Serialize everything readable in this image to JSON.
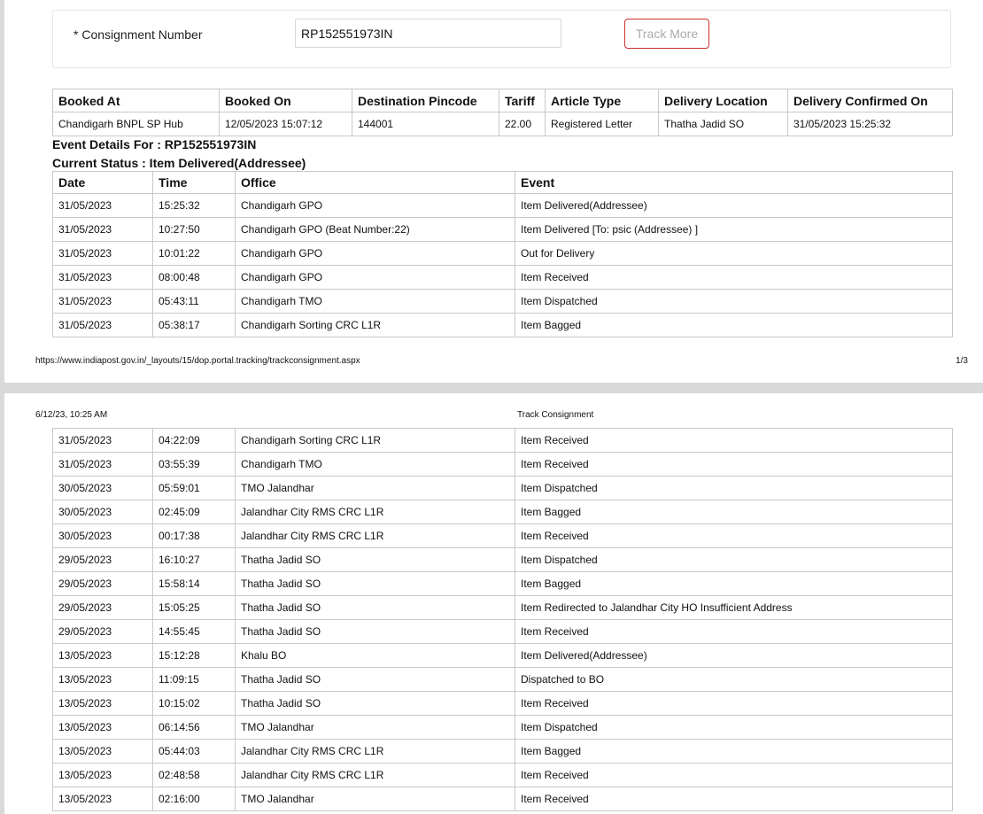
{
  "form": {
    "label": "* Consignment Number",
    "value": "RP152551973IN",
    "track_more_label": "Track More"
  },
  "booking": {
    "headers": [
      "Booked At",
      "Booked On",
      "Destination Pincode",
      "Tariff",
      "Article Type",
      "Delivery Location",
      "Delivery Confirmed On"
    ],
    "row": [
      "Chandigarh BNPL SP Hub",
      "12/05/2023 15:07:12",
      "144001",
      "22.00",
      "Registered Letter",
      "Thatha Jadid SO",
      "31/05/2023 15:25:32"
    ]
  },
  "event_details_title": "Event Details For : RP152551973IN",
  "current_status": "Current Status : Item Delivered(Addressee)",
  "events": {
    "headers": [
      "Date",
      "Time",
      "Office",
      "Event"
    ],
    "rows": [
      [
        "31/05/2023",
        "15:25:32",
        "Chandigarh GPO",
        "Item Delivered(Addressee)"
      ],
      [
        "31/05/2023",
        "10:27:50",
        "Chandigarh GPO (Beat Number:22)",
        "Item Delivered [To: psic (Addressee) ]"
      ],
      [
        "31/05/2023",
        "10:01:22",
        "Chandigarh GPO",
        "Out for Delivery"
      ],
      [
        "31/05/2023",
        "08:00:48",
        "Chandigarh GPO",
        "Item Received"
      ],
      [
        "31/05/2023",
        "05:43:11",
        "Chandigarh TMO",
        "Item Dispatched"
      ],
      [
        "31/05/2023",
        "05:38:17",
        "Chandigarh Sorting CRC L1R",
        "Item Bagged"
      ],
      [
        "31/05/2023",
        "04:22:09",
        "Chandigarh Sorting CRC L1R",
        "Item Received"
      ],
      [
        "31/05/2023",
        "03:55:39",
        "Chandigarh TMO",
        "Item Received"
      ],
      [
        "30/05/2023",
        "05:59:01",
        "TMO Jalandhar",
        "Item Dispatched"
      ],
      [
        "30/05/2023",
        "02:45:09",
        "Jalandhar City RMS CRC L1R",
        "Item Bagged"
      ],
      [
        "30/05/2023",
        "00:17:38",
        "Jalandhar City RMS CRC L1R",
        "Item Received"
      ],
      [
        "29/05/2023",
        "16:10:27",
        "Thatha Jadid SO",
        "Item Dispatched"
      ],
      [
        "29/05/2023",
        "15:58:14",
        "Thatha Jadid SO",
        "Item Bagged"
      ],
      [
        "29/05/2023",
        "15:05:25",
        "Thatha Jadid SO",
        "Item Redirected to Jalandhar City HO Insufficient Address"
      ],
      [
        "29/05/2023",
        "14:55:45",
        "Thatha Jadid SO",
        "Item Received"
      ],
      [
        "13/05/2023",
        "15:12:28",
        "Khalu BO",
        "Item Delivered(Addressee)"
      ],
      [
        "13/05/2023",
        "11:09:15",
        "Thatha Jadid SO",
        "Dispatched to BO"
      ],
      [
        "13/05/2023",
        "10:15:02",
        "Thatha Jadid SO",
        "Item Received"
      ],
      [
        "13/05/2023",
        "06:14:56",
        "TMO Jalandhar",
        "Item Dispatched"
      ],
      [
        "13/05/2023",
        "05:44:03",
        "Jalandhar City RMS CRC L1R",
        "Item Bagged"
      ],
      [
        "13/05/2023",
        "02:48:58",
        "Jalandhar City RMS CRC L1R",
        "Item Received"
      ],
      [
        "13/05/2023",
        "02:16:00",
        "TMO Jalandhar",
        "Item Received"
      ]
    ]
  },
  "page1_footer": {
    "url": "https://www.indiapost.gov.in/_layouts/15/dop.portal.tracking/trackconsignment.aspx",
    "page": "1/3"
  },
  "page2_header": {
    "datetime": "6/12/23, 10:25 AM",
    "title": "Track Consignment"
  }
}
